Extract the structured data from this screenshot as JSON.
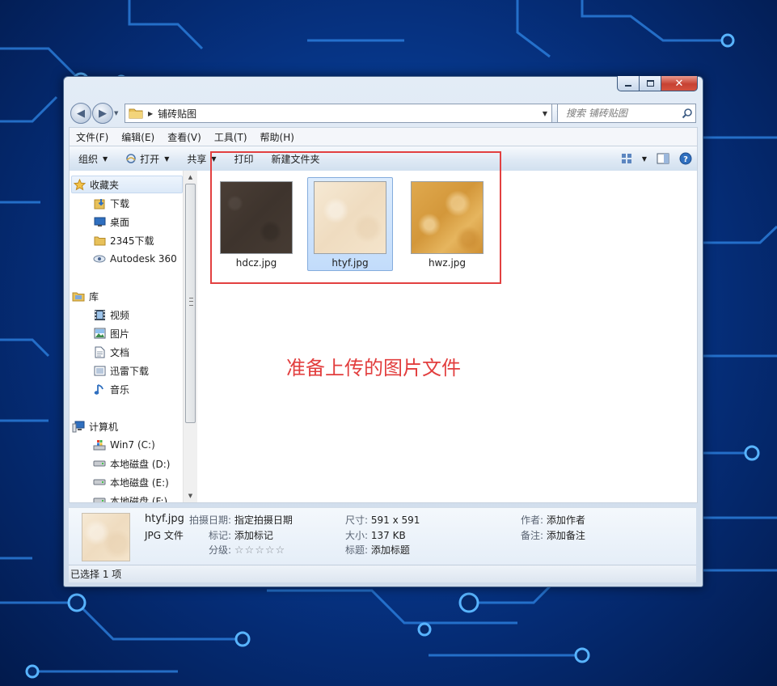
{
  "colors": {
    "annotation": "#e23e3e",
    "selection": "#c2dcfb",
    "desktop": "#073c94"
  },
  "window": {
    "close_glyph": "✕"
  },
  "address": {
    "path": "铺砖贴图"
  },
  "search": {
    "placeholder": "搜索 铺砖贴图"
  },
  "menu": [
    "文件(F)",
    "编辑(E)",
    "查看(V)",
    "工具(T)",
    "帮助(H)"
  ],
  "toolbar": {
    "organize": "组织",
    "open": "打开",
    "share": "共享",
    "print": "打印",
    "new_folder": "新建文件夹"
  },
  "sidebar": {
    "favorites": {
      "label": "收藏夹",
      "items": [
        "下载",
        "桌面",
        "2345下载",
        "Autodesk 360"
      ]
    },
    "libraries": {
      "label": "库",
      "items": [
        "视频",
        "图片",
        "文档",
        "迅雷下载",
        "音乐"
      ]
    },
    "computer": {
      "label": "计算机",
      "items": [
        "Win7 (C:)",
        "本地磁盘 (D:)",
        "本地磁盘 (E:)",
        "本地磁盘 (F:)"
      ]
    }
  },
  "files": [
    {
      "name": "hdcz.jpg",
      "selected": false
    },
    {
      "name": "htyf.jpg",
      "selected": true
    },
    {
      "name": "hwz.jpg",
      "selected": false
    }
  ],
  "annotation": "准备上传的图片文件",
  "details": {
    "file_name": "htyf.jpg",
    "file_type": "JPG 文件",
    "date_taken_label": "拍摄日期:",
    "date_taken_value": "指定拍摄日期",
    "tags_label": "标记:",
    "tags_value": "添加标记",
    "rating_label": "分级:",
    "rating_stars": 0,
    "dimensions_label": "尺寸:",
    "dimensions_value": "591 x 591",
    "size_label": "大小:",
    "size_value": "137 KB",
    "title_label": "标题:",
    "title_value": "添加标题",
    "author_label": "作者:",
    "author_value": "添加作者",
    "comments_label": "备注:",
    "comments_value": "添加备注"
  },
  "status": "已选择 1 项"
}
